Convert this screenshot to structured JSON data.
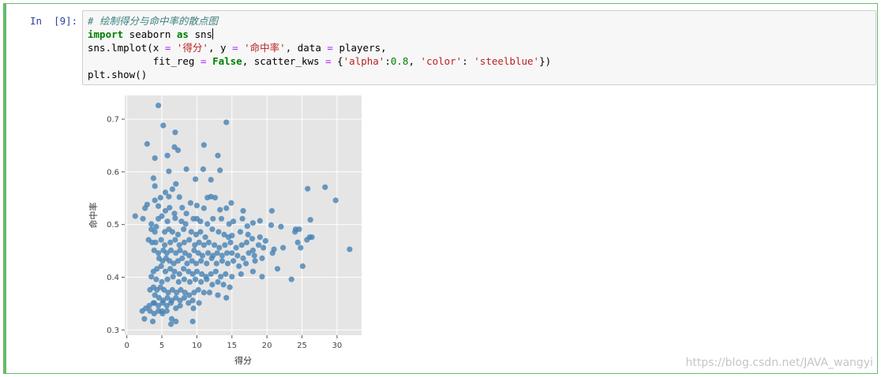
{
  "cell": {
    "prompt": "In  [9]:",
    "code": {
      "comment": "# 绘制得分与命中率的散点图",
      "import_kw": "import",
      "import_mod": " seaborn ",
      "as_kw": "as",
      "alias": " sns",
      "l3_a": "sns.lmplot(x ",
      "eq": "=",
      "sp": " ",
      "str_x": "'得分'",
      "l3_b": ", y ",
      "str_y": "'命中率'",
      "l3_c": ", data ",
      "l3_d": " players,",
      "l4_a": "           fit_reg ",
      "false_kw": "False",
      "l4_b": ", scatter_kws ",
      "l4_c": " {",
      "str_alpha": "'alpha'",
      "colon": ":",
      "num_alpha": "0.8",
      "l4_d": ", ",
      "str_color": "'color'",
      "colon_sp": ": ",
      "str_steelblue": "'steelblue'",
      "l4_e": "})",
      "l5": "plt.show()"
    }
  },
  "watermark": "https://blog.csdn.net/JAVA_wangyi",
  "chart_data": {
    "type": "scatter",
    "xlabel": "得分",
    "ylabel": "命中率",
    "xlim": [
      -0.3,
      33.5
    ],
    "ylim": [
      0.29,
      0.745
    ],
    "xticks": [
      0,
      5,
      10,
      15,
      20,
      25,
      30
    ],
    "yticks": [
      0.3,
      0.4,
      0.5,
      0.6,
      0.7
    ],
    "grid": true,
    "background": "#e5e5e5",
    "point_color": "#4682b4",
    "point_alpha": 0.8,
    "x": [
      4.5,
      5.2,
      6.9,
      14.2,
      2.9,
      6.8,
      7.3,
      4.0,
      5.8,
      11.0,
      13.0,
      3.8,
      6.0,
      8.5,
      10.9,
      12.0,
      13.3,
      4.0,
      7.0,
      6.5,
      5.5,
      7.5,
      6.0,
      9.8,
      4.0,
      4.8,
      9.1,
      11.5,
      12.0,
      12.6,
      14.9,
      2.6,
      2.9,
      4.5,
      5.5,
      6.1,
      6.8,
      7.9,
      8.5,
      10.0,
      11.0,
      13.3,
      14.2,
      16.6,
      25.8,
      28.3,
      29.8,
      1.2,
      2.3,
      3.5,
      4.5,
      5.0,
      5.8,
      6.9,
      7.8,
      8.4,
      9.5,
      10.0,
      10.5,
      11.5,
      12.3,
      13.5,
      14.6,
      15.2,
      16.5,
      17.2,
      18.0,
      19.0,
      20.7,
      22.0,
      24.1,
      24.6,
      26.2,
      26.4,
      3.5,
      4.0,
      4.2,
      5.4,
      6.0,
      6.5,
      7.3,
      8.1,
      9.2,
      9.9,
      10.5,
      11.2,
      12.2,
      13.1,
      13.9,
      14.5,
      15.0,
      16.2,
      17.3,
      17.9,
      19.0,
      19.8,
      20.6,
      24.0,
      25.7,
      26.1,
      3.1,
      3.6,
      4.1,
      4.9,
      5.4,
      6.2,
      6.9,
      7.5,
      8.2,
      8.9,
      9.7,
      10.3,
      11.0,
      11.7,
      12.5,
      13.2,
      14.0,
      14.8,
      15.6,
      16.4,
      17.1,
      18.0,
      18.8,
      19.5,
      21.0,
      22.3,
      24.4,
      31.8,
      3.9,
      4.5,
      5.2,
      5.7,
      6.3,
      7.0,
      7.6,
      8.3,
      8.9,
      9.6,
      10.2,
      10.8,
      11.6,
      12.3,
      12.9,
      13.6,
      14.3,
      15.0,
      15.8,
      16.6,
      17.4,
      18.2,
      19.3,
      20.8,
      24.8,
      4.6,
      5.1,
      5.6,
      6.1,
      6.7,
      7.3,
      7.9,
      8.6,
      9.3,
      9.9,
      10.6,
      11.4,
      12.1,
      12.8,
      13.6,
      14.4,
      15.2,
      16.0,
      17.0,
      18.3,
      21.5,
      25.1,
      3.8,
      4.3,
      4.9,
      5.5,
      6.2,
      6.8,
      7.5,
      8.1,
      8.8,
      9.4,
      10.0,
      10.7,
      11.3,
      12.0,
      12.7,
      13.4,
      14.1,
      15.0,
      16.3,
      18.0,
      19.3,
      23.5,
      3.5,
      4.2,
      5.0,
      5.8,
      6.6,
      7.4,
      8.2,
      9.0,
      9.8,
      10.6,
      11.4,
      12.2,
      13.0,
      13.8,
      14.7,
      3.3,
      3.8,
      4.3,
      4.8,
      5.3,
      5.9,
      6.5,
      7.1,
      7.7,
      8.3,
      8.9,
      9.6,
      10.2,
      11.0,
      11.8,
      13.0,
      14.2,
      4.0,
      4.6,
      5.2,
      5.8,
      6.4,
      7.0,
      7.6,
      8.2,
      8.8,
      9.4,
      10.3,
      3.2,
      3.9,
      4.5,
      5.1,
      5.7,
      6.3,
      7.0,
      7.6,
      9.5,
      2.2,
      2.7,
      3.3,
      3.9,
      4.5,
      5.1,
      5.7,
      6.4,
      7.0,
      2.5,
      3.7,
      5.0,
      6.3,
      9.4,
      3.8,
      5.3,
      2.4
    ],
    "y": [
      0.726,
      0.688,
      0.675,
      0.694,
      0.653,
      0.647,
      0.641,
      0.626,
      0.631,
      0.651,
      0.631,
      0.588,
      0.601,
      0.605,
      0.605,
      0.585,
      0.603,
      0.573,
      0.577,
      0.567,
      0.561,
      0.552,
      0.553,
      0.586,
      0.546,
      0.551,
      0.541,
      0.551,
      0.553,
      0.551,
      0.541,
      0.531,
      0.538,
      0.535,
      0.526,
      0.532,
      0.521,
      0.532,
      0.521,
      0.536,
      0.531,
      0.528,
      0.531,
      0.526,
      0.568,
      0.571,
      0.546,
      0.516,
      0.511,
      0.501,
      0.511,
      0.516,
      0.506,
      0.512,
      0.506,
      0.501,
      0.511,
      0.511,
      0.506,
      0.501,
      0.511,
      0.511,
      0.501,
      0.506,
      0.511,
      0.497,
      0.503,
      0.507,
      0.526,
      0.496,
      0.491,
      0.491,
      0.509,
      0.476,
      0.491,
      0.486,
      0.496,
      0.486,
      0.491,
      0.486,
      0.481,
      0.491,
      0.486,
      0.481,
      0.486,
      0.476,
      0.491,
      0.486,
      0.481,
      0.476,
      0.479,
      0.486,
      0.481,
      0.473,
      0.476,
      0.469,
      0.499,
      0.486,
      0.471,
      0.476,
      0.471,
      0.466,
      0.466,
      0.471,
      0.461,
      0.466,
      0.471,
      0.461,
      0.466,
      0.471,
      0.461,
      0.466,
      0.461,
      0.466,
      0.461,
      0.456,
      0.461,
      0.466,
      0.456,
      0.461,
      0.466,
      0.451,
      0.461,
      0.456,
      0.453,
      0.456,
      0.466,
      0.453,
      0.451,
      0.446,
      0.451,
      0.446,
      0.451,
      0.446,
      0.451,
      0.446,
      0.441,
      0.451,
      0.446,
      0.441,
      0.446,
      0.441,
      0.446,
      0.441,
      0.446,
      0.446,
      0.441,
      0.436,
      0.446,
      0.441,
      0.436,
      0.446,
      0.456,
      0.436,
      0.431,
      0.436,
      0.431,
      0.426,
      0.431,
      0.436,
      0.426,
      0.431,
      0.426,
      0.431,
      0.426,
      0.436,
      0.426,
      0.431,
      0.426,
      0.431,
      0.421,
      0.426,
      0.431,
      0.416,
      0.421,
      0.411,
      0.416,
      0.421,
      0.411,
      0.416,
      0.411,
      0.406,
      0.416,
      0.411,
      0.406,
      0.411,
      0.406,
      0.401,
      0.406,
      0.411,
      0.401,
      0.406,
      0.401,
      0.406,
      0.411,
      0.401,
      0.396,
      0.401,
      0.396,
      0.391,
      0.396,
      0.401,
      0.391,
      0.396,
      0.391,
      0.396,
      0.391,
      0.396,
      0.386,
      0.391,
      0.386,
      0.381,
      0.376,
      0.381,
      0.376,
      0.381,
      0.376,
      0.371,
      0.376,
      0.371,
      0.376,
      0.371,
      0.366,
      0.371,
      0.376,
      0.371,
      0.371,
      0.366,
      0.361,
      0.366,
      0.361,
      0.356,
      0.361,
      0.356,
      0.361,
      0.356,
      0.361,
      0.351,
      0.356,
      0.351,
      0.346,
      0.351,
      0.346,
      0.351,
      0.346,
      0.351,
      0.341,
      0.346,
      0.341,
      0.336,
      0.341,
      0.336,
      0.331,
      0.336,
      0.331,
      0.336,
      0.321,
      0.316,
      0.321,
      0.316,
      0.336,
      0.311,
      0.316,
      0.351
    ]
  }
}
